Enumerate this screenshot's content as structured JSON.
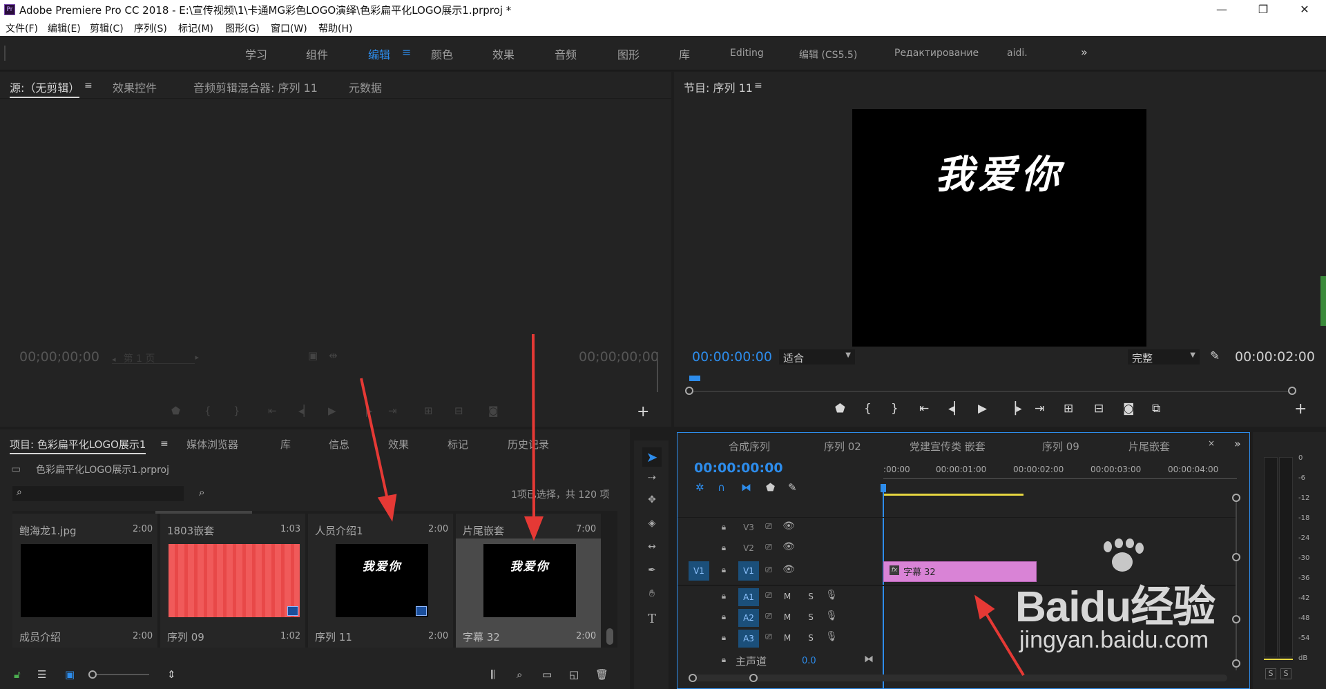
{
  "window": {
    "app_logo": "Pr",
    "title": "Adobe Premiere Pro CC 2018 - E:\\宣传视频\\1\\卡通MG彩色LOGO演绎\\色彩扁平化LOGO展示1.prproj *",
    "minimize_icon": "minimize-icon",
    "restore_icon": "restore-icon",
    "close_icon": "close-icon"
  },
  "menu": [
    "文件(F)",
    "编辑(E)",
    "剪辑(C)",
    "序列(S)",
    "标记(M)",
    "图形(G)",
    "窗口(W)",
    "帮助(H)"
  ],
  "workspaces": [
    "学习",
    "组件",
    "编辑",
    "颜色",
    "效果",
    "音频",
    "图形",
    "库",
    "Editing",
    "编辑 (CS5.5)",
    "Редактирование",
    "aidi."
  ],
  "workspace_active": "编辑",
  "workspace_menu": "≡",
  "workspace_more": "»",
  "source_panel": {
    "tabs": [
      "源:（无剪辑）",
      "效果控件",
      "音频剪辑混合器: 序列 11",
      "元数据"
    ],
    "menu": "≡",
    "timecode_in": "00;00;00;00",
    "timecode_out": "00;00;00;00",
    "page_select": "第 1 页"
  },
  "program_panel": {
    "title": "节目: 序列 11",
    "menu": "≡",
    "preview_text": "我爱你",
    "timecode": "00:00:00:00",
    "fit": "适合",
    "quality": "完整",
    "duration": "00:00:02:00"
  },
  "project_panel": {
    "tabs": [
      "项目: 色彩扁平化LOGO展示1",
      "媒体浏览器",
      "库",
      "信息",
      "效果",
      "标记",
      "历史记录"
    ],
    "menu": "≡",
    "file": "色彩扁平化LOGO展示1.prproj",
    "status": "1项已选择，共 120 项",
    "search_placeholder": "",
    "items_top": [
      {
        "name": "鲍海龙1.jpg",
        "dur": "2:00"
      },
      {
        "name": "1803嵌套",
        "dur": "1:03"
      },
      {
        "name": "人员介绍1",
        "dur": "2:00"
      },
      {
        "name": "片尾嵌套",
        "dur": "7:00"
      }
    ],
    "items": [
      {
        "name": "成员介绍",
        "dur": "2:00"
      },
      {
        "name": "序列 09",
        "dur": "1:02"
      },
      {
        "name": "序列 11",
        "dur": "2:00"
      },
      {
        "name": "字幕 32",
        "dur": "2:00"
      }
    ],
    "thumb_text": "我爱你"
  },
  "timeline": {
    "tabs": [
      "合成序列",
      "序列 02",
      "党建宣传类 嵌套",
      "序列 09",
      "片尾嵌套"
    ],
    "close": "×",
    "more": "»",
    "timecode": "00:00:00:00",
    "ruler": [
      ":00:00",
      "00:00:01:00",
      "00:00:02:00",
      "00:00:03:00",
      "00:00:04:00"
    ],
    "video_tracks": [
      "V3",
      "V2",
      "V1"
    ],
    "audio_tracks": [
      "A1",
      "A2",
      "A3"
    ],
    "source_patch": "V1",
    "mute": "M",
    "solo": "S",
    "master": "主声道",
    "master_value": "0.0",
    "clip_label": "字幕 32",
    "clip_fx": "fx"
  },
  "meter": {
    "scale": [
      "0",
      "-6",
      "-12",
      "-18",
      "-24",
      "-30",
      "-36",
      "-42",
      "-48",
      "-54",
      "dB"
    ],
    "solo_buttons": [
      "S",
      "S"
    ]
  },
  "watermark": {
    "brand": "Baidu经验",
    "url": "jingyan.baidu.com"
  },
  "colors": {
    "accent": "#2d8ceb",
    "clip": "#d983d6",
    "arrow": "#e53935",
    "workarea": "#e6d640"
  }
}
